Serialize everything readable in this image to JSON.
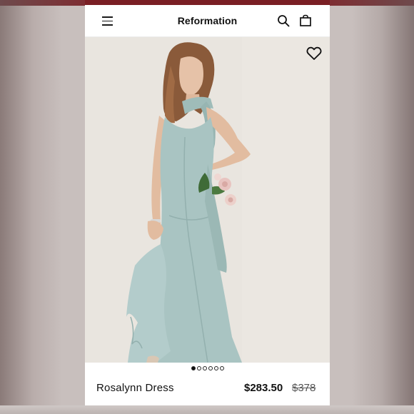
{
  "header": {
    "brand": "Reformation",
    "menu_icon": "hamburger-menu-icon",
    "search_icon": "search-icon",
    "bag_icon": "shopping-bag-icon"
  },
  "hero": {
    "favorite_icon": "heart-outline-icon",
    "carousel": {
      "total": 6,
      "active_index": 0
    }
  },
  "product": {
    "name": "Rosalynn Dress",
    "price": "$283.50",
    "original_price": "$378"
  },
  "colors": {
    "accent": "#7a1f24",
    "dress": "#a9c4c2",
    "background": "#e8e4de"
  }
}
